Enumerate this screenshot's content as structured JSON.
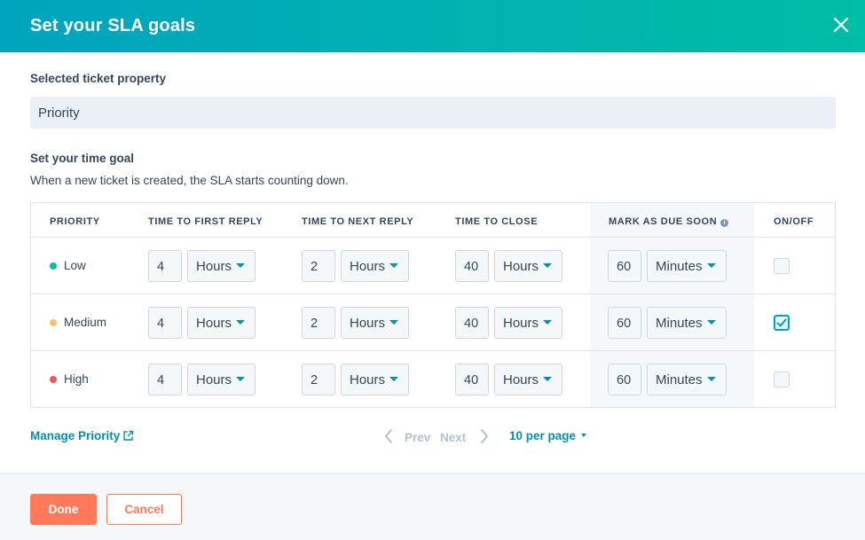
{
  "dialog": {
    "title": "Set your SLA goals"
  },
  "property": {
    "label": "Selected ticket property",
    "value": "Priority"
  },
  "time_goal": {
    "label": "Set your time goal",
    "help": "When a new ticket is created, the SLA starts counting down."
  },
  "table": {
    "headers": {
      "priority": "PRIORITY",
      "first_reply": "TIME TO FIRST REPLY",
      "next_reply": "TIME TO NEXT REPLY",
      "close": "TIME TO CLOSE",
      "due_soon": "MARK AS DUE SOON",
      "onoff": "ON/OFF"
    },
    "info_icon": "i",
    "rows": [
      {
        "priority": "Low",
        "dot_color": "#00bda5",
        "first_reply": {
          "value": "4",
          "unit": "Hours"
        },
        "next_reply": {
          "value": "2",
          "unit": "Hours"
        },
        "close": {
          "value": "40",
          "unit": "Hours"
        },
        "due_soon": {
          "value": "60",
          "unit": "Minutes"
        },
        "enabled": false
      },
      {
        "priority": "Medium",
        "dot_color": "#f5c26b",
        "first_reply": {
          "value": "4",
          "unit": "Hours"
        },
        "next_reply": {
          "value": "2",
          "unit": "Hours"
        },
        "close": {
          "value": "40",
          "unit": "Hours"
        },
        "due_soon": {
          "value": "60",
          "unit": "Minutes"
        },
        "enabled": true
      },
      {
        "priority": "High",
        "dot_color": "#f2545b",
        "first_reply": {
          "value": "4",
          "unit": "Hours"
        },
        "next_reply": {
          "value": "2",
          "unit": "Hours"
        },
        "close": {
          "value": "40",
          "unit": "Hours"
        },
        "due_soon": {
          "value": "60",
          "unit": "Minutes"
        },
        "enabled": false
      }
    ]
  },
  "manage_link": "Manage Priority",
  "pagination": {
    "prev": "Prev",
    "next": "Next",
    "per_page": "10 per page"
  },
  "footer": {
    "done": "Done",
    "cancel": "Cancel"
  },
  "colors": {
    "accent": "#00a4bd",
    "primary_button": "#ff7a59",
    "link": "#0091ae"
  }
}
